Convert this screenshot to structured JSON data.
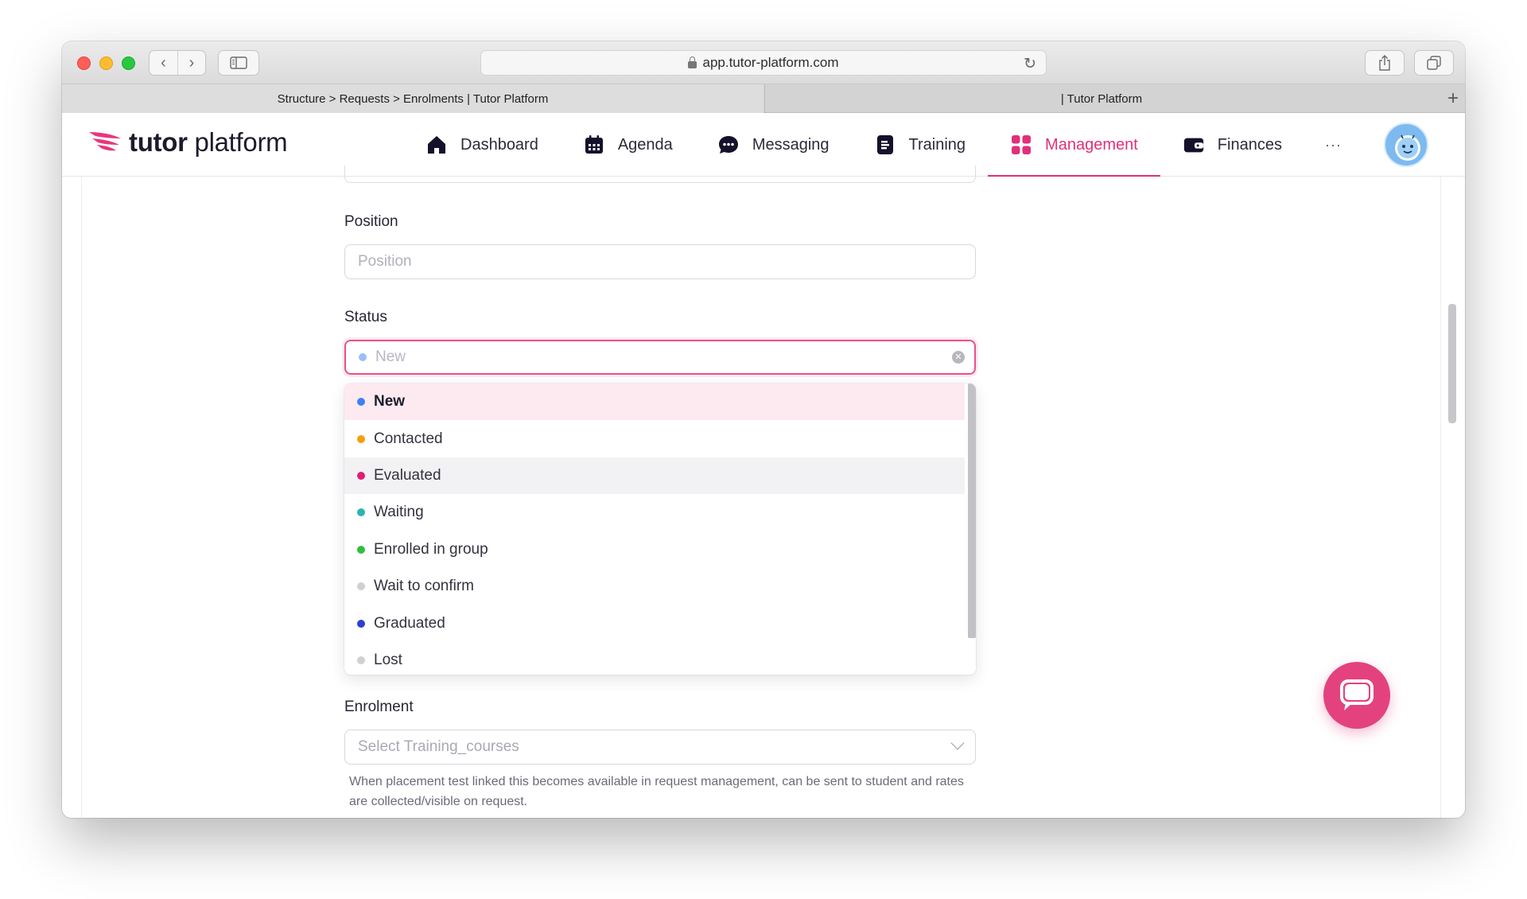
{
  "browser": {
    "url": "app.tutor-platform.com",
    "tabs": [
      {
        "label": "Structure > Requests > Enrolments | Tutor Platform"
      },
      {
        "label": "| Tutor Platform"
      }
    ],
    "new_tab_symbol": "+"
  },
  "app": {
    "logo": {
      "bold": "tutor",
      "light": "platform"
    },
    "accent_color": "#e0307a",
    "nav": [
      {
        "label": "Dashboard",
        "icon": "home-icon"
      },
      {
        "label": "Agenda",
        "icon": "calendar-icon"
      },
      {
        "label": "Messaging",
        "icon": "chat-bubble-icon"
      },
      {
        "label": "Training",
        "icon": "document-icon"
      },
      {
        "label": "Management",
        "icon": "grid-icon",
        "active": true
      },
      {
        "label": "Finances",
        "icon": "wallet-icon"
      }
    ],
    "nav_more": "···"
  },
  "form": {
    "position": {
      "label": "Position",
      "placeholder": "Position"
    },
    "status": {
      "label": "Status",
      "selected": "New",
      "options": [
        {
          "label": "New",
          "color": "#3b82f6"
        },
        {
          "label": "Contacted",
          "color": "#f59e0b"
        },
        {
          "label": "Evaluated",
          "color": "#e11d74"
        },
        {
          "label": "Waiting",
          "color": "#2cb5b0"
        },
        {
          "label": "Enrolled in group",
          "color": "#2fbf3a"
        },
        {
          "label": "Wait to confirm",
          "color": "#cfcfd4"
        },
        {
          "label": "Graduated",
          "color": "#2f3fd6"
        },
        {
          "label": "Lost",
          "color": "#cfcfd4"
        }
      ]
    },
    "enrolment": {
      "label": "Enrolment",
      "placeholder": "Select Training_courses",
      "help": "When placement test linked this becomes available in request management, can be sent to student and rates are collected/visible on request."
    }
  }
}
